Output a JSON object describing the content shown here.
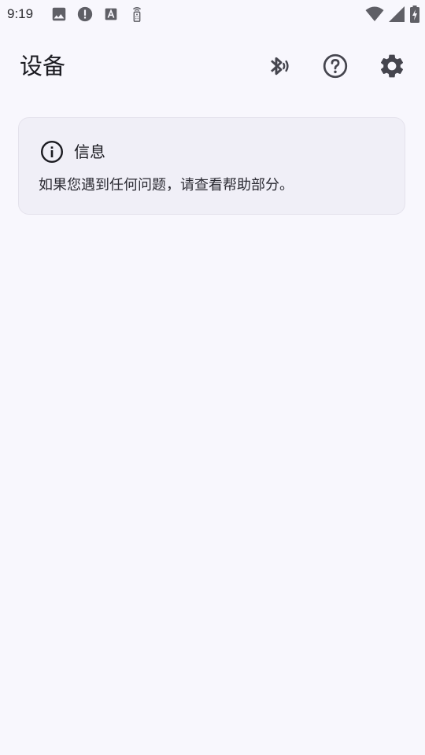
{
  "status_bar": {
    "time": "9:19",
    "left_icons": [
      "image-icon",
      "alert-circle-icon",
      "font-a-icon",
      "remote-icon"
    ],
    "right_icons": [
      "wifi-icon",
      "signal-icon",
      "battery-charging-icon"
    ]
  },
  "app_bar": {
    "title": "设备",
    "actions": [
      "bluetooth-audio-icon",
      "help-icon",
      "settings-gear-icon"
    ]
  },
  "info_card": {
    "title": "信息",
    "message": "如果您遇到任何问题，请查看帮助部分。",
    "icon": "info-icon"
  },
  "colors": {
    "background": "#f8f7fd",
    "card": "#f0eff7",
    "card_border": "#e4e2ec",
    "text": "#1b1b21"
  }
}
